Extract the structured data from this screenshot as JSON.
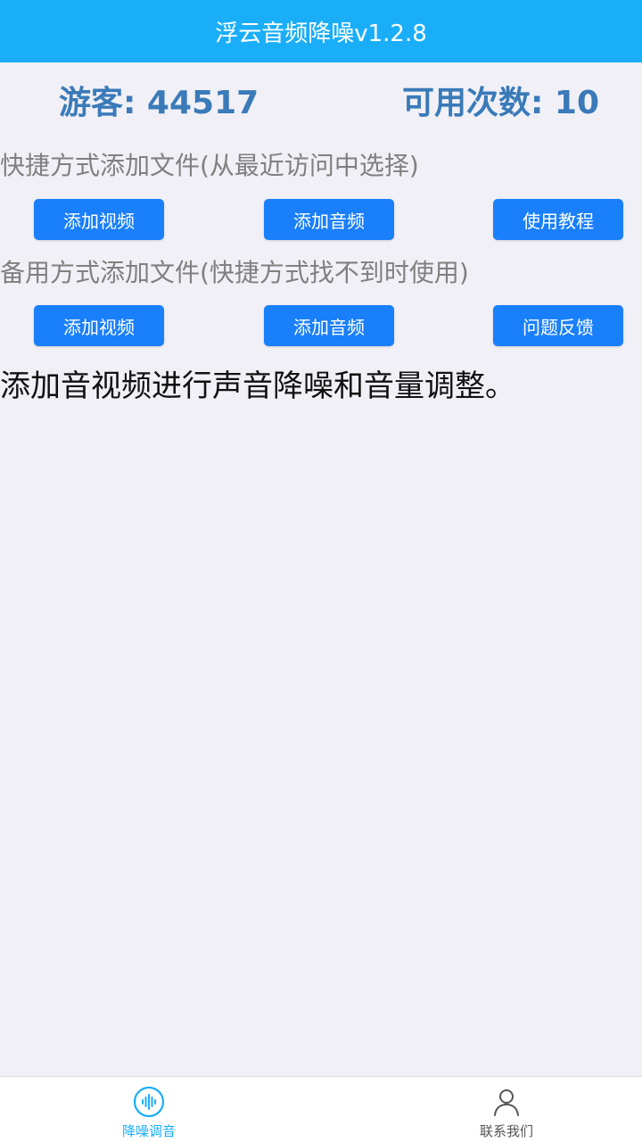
{
  "header": {
    "title": "浮云音频降噪v1.2.8"
  },
  "stats": {
    "guest": "游客: 44517",
    "remaining": "可用次数: 10"
  },
  "quick": {
    "label": "快捷方式添加文件(从最近访问中选择)",
    "buttons": [
      "添加视频",
      "添加音频",
      "使用教程"
    ]
  },
  "backup": {
    "label": "备用方式添加文件(快捷方式找不到时使用)",
    "buttons": [
      "添加视频",
      "添加音频",
      "问题反馈"
    ]
  },
  "description": "添加音视频进行声音降噪和音量调整。",
  "tabbar": {
    "items": [
      {
        "label": "降噪调音",
        "icon": "sound-wave-icon",
        "active": true
      },
      {
        "label": "联系我们",
        "icon": "person-icon",
        "active": false
      }
    ]
  },
  "colors": {
    "header": "#1aaef8",
    "button": "#1a7ffa",
    "stats_text": "#3a7ab8",
    "background": "#f0f0f6"
  }
}
